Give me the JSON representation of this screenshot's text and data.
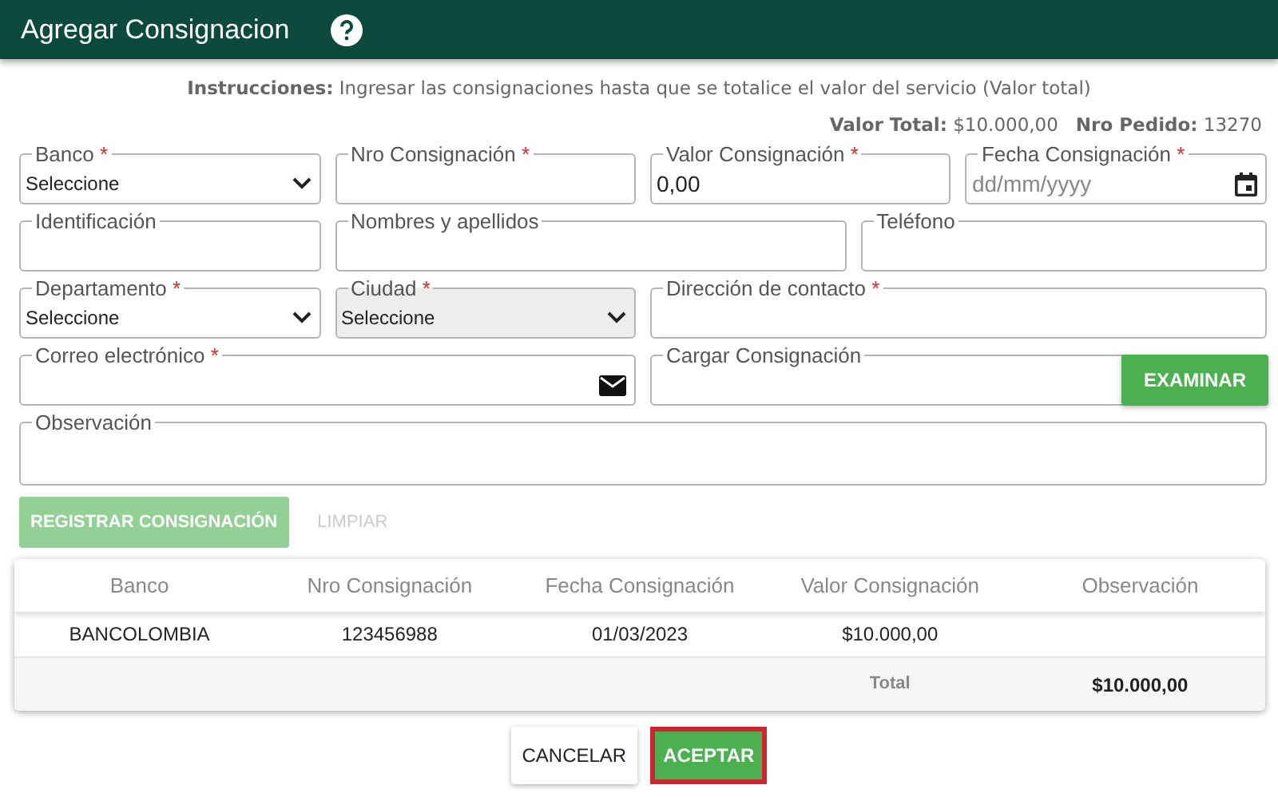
{
  "header": {
    "title": "Agregar Consignacion"
  },
  "instructions": "**Instrucciones:** Ingresar las consignaciones hasta que se totalice el valor del servicio (Valor total)",
  "summary": "**Valor Total:** $10.000,00   **Nro Pedido:** 13270",
  "form_rows": [
    [
      {
        "kind": "select",
        "label": "Banco",
        "required_mark": "*",
        "value": "Seleccione",
        "disabled": false
      },
      {
        "kind": "text",
        "label": "Nro Consignación",
        "required_mark": "*"
      },
      {
        "kind": "text",
        "label": "Valor Consignación",
        "required_mark": "*",
        "value": "0,00"
      },
      {
        "kind": "date",
        "label": "Fecha Consignación",
        "required_mark": "*",
        "placeholder": "dd/mm/yyyy"
      }
    ],
    [
      {
        "kind": "text",
        "label": "Identificación"
      },
      {
        "kind": "text",
        "label": "Nombres y apellidos"
      },
      {
        "kind": "text",
        "label": "Teléfono"
      }
    ],
    [
      {
        "kind": "select",
        "label": "Departamento",
        "required_mark": "*",
        "value": "Seleccione",
        "disabled": false
      },
      {
        "kind": "select",
        "label": "Ciudad",
        "required_mark": "*",
        "value": "Seleccione",
        "disabled": true
      },
      {
        "kind": "text",
        "label": "Dirección de contacto",
        "required_mark": "*"
      }
    ],
    [
      {
        "kind": "email",
        "label": "Correo electrónico",
        "required_mark": "*"
      },
      {
        "kind": "file",
        "label": "Cargar Consignación",
        "button": "EXAMINAR"
      }
    ],
    [
      {
        "kind": "textarea",
        "label": "Observación"
      }
    ]
  ],
  "actions": [
    {
      "label": "REGISTRAR CONSIGNACIÓN",
      "kind": "primary",
      "disabled": true
    },
    {
      "label": "LIMPIAR",
      "kind": "link",
      "disabled": true
    }
  ],
  "table": {
    "columns": [
      "Banco",
      "Nro Consignación",
      "Fecha Consignación",
      "Valor Consignación",
      "Observación"
    ],
    "rows": [
      [
        "BANCOLOMBIA",
        "123456988",
        "01/03/2023",
        "$10.000,00",
        ""
      ]
    ],
    "total": {
      "label": "Total",
      "value": "$10.000,00"
    }
  },
  "footer_buttons": [
    {
      "label": "CANCELAR",
      "kind": "secondary",
      "highlighted": false
    },
    {
      "label": "ACEPTAR",
      "kind": "primary",
      "highlighted": true
    }
  ]
}
